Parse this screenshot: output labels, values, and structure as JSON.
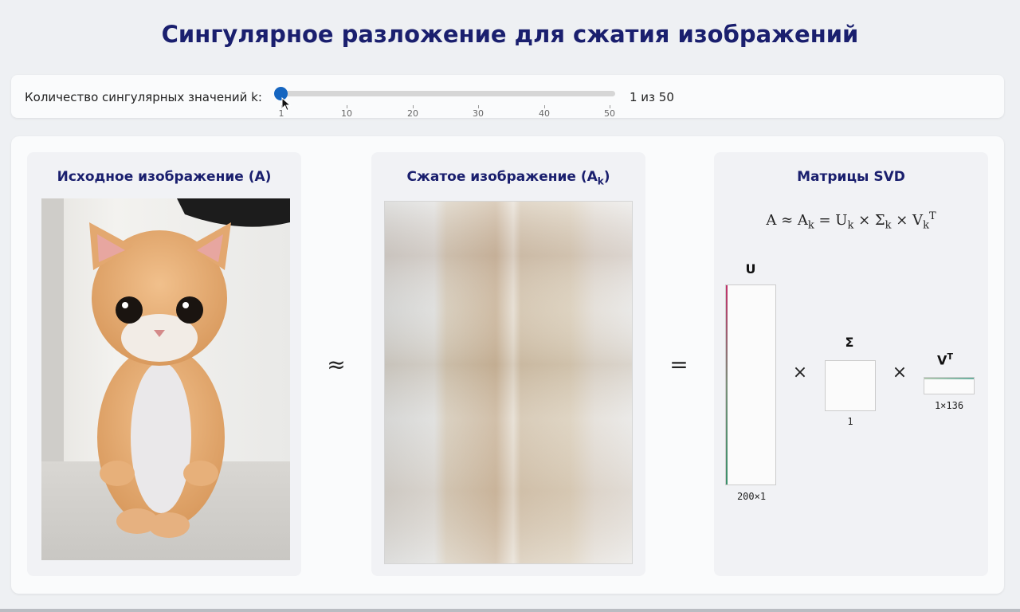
{
  "title": "Сингулярное разложение для сжатия изображений",
  "control": {
    "label": "Количество сингулярных значений k:",
    "value": 1,
    "min": 1,
    "max": 50,
    "value_text": "1 из 50",
    "ticks": [
      "1",
      "10",
      "20",
      "30",
      "40",
      "50"
    ]
  },
  "original": {
    "title": "Исходное изображение (A)"
  },
  "compressed": {
    "title_main": "Сжатое изображение (A",
    "title_sub": "k",
    "title_end": ")"
  },
  "approx_symbol": "≈",
  "equals_symbol": "=",
  "svd": {
    "title": "Матрицы SVD",
    "formula": {
      "a": "A ≈ A",
      "k1": "k",
      "eq": " = U",
      "k2": "k",
      "times1": " × Σ",
      "k3": "k",
      "times2": " × V",
      "k4": "k",
      "t": "T"
    },
    "u_label": "U",
    "u_dims": "200×1",
    "sigma_label": "Σ",
    "sigma_dims": "1",
    "vt_label": "V",
    "vt_sup": "T",
    "vt_dims": "1×136",
    "times_symbol": "×"
  },
  "colors": {
    "title": "#1a1f6e",
    "slider_thumb": "#1565c0"
  },
  "icons": {
    "cursor": "pointer-cursor-icon"
  }
}
